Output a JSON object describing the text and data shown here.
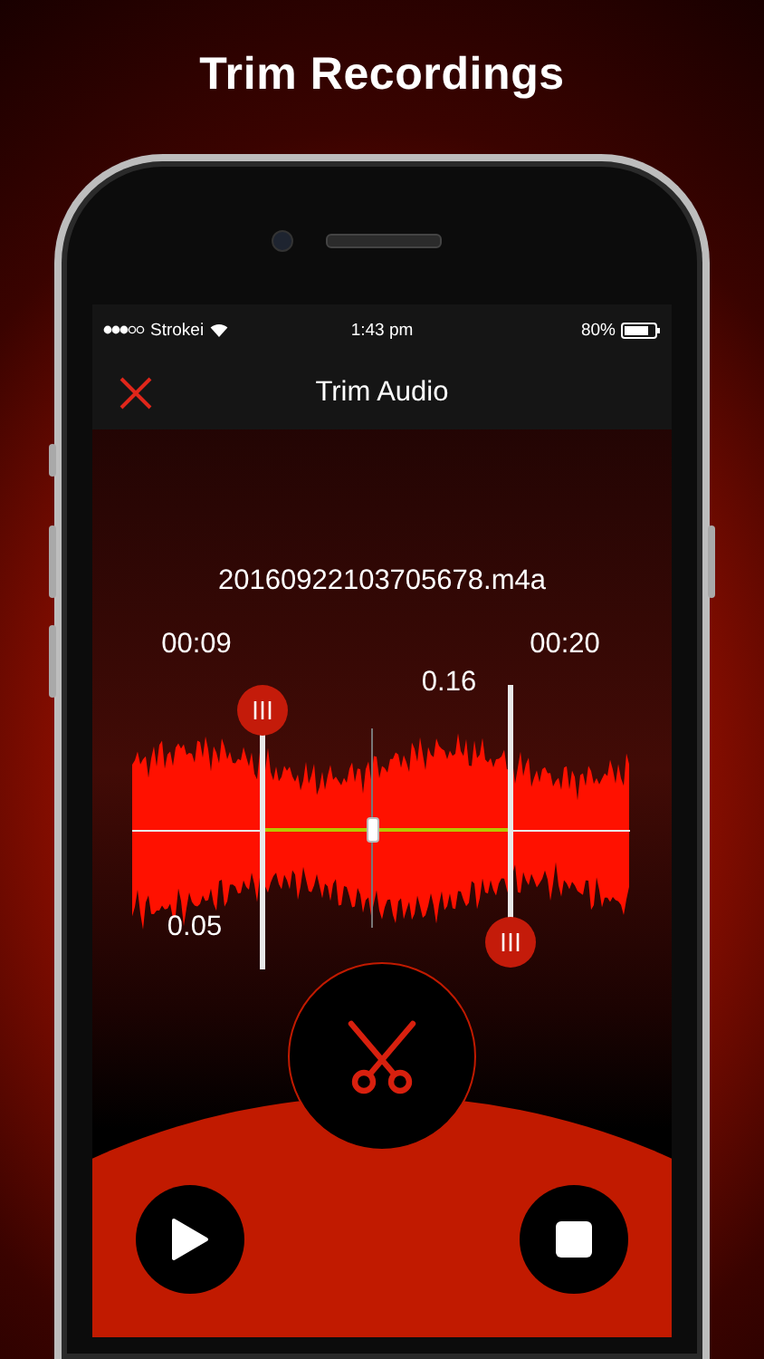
{
  "headline": "Trim Recordings",
  "status_bar": {
    "carrier": "Strokei",
    "time": "1:43 pm",
    "battery": "80%"
  },
  "nav_bar": {
    "title": "Trim Audio"
  },
  "file_name": "20160922103705678.m4a",
  "start_handle": {
    "level": 0.26,
    "time": "00:09",
    "value": "0.05"
  },
  "end_handle": {
    "level": 0.76,
    "time": "00:20",
    "value": "0.16"
  },
  "playhead": {
    "level": 0.48
  }
}
